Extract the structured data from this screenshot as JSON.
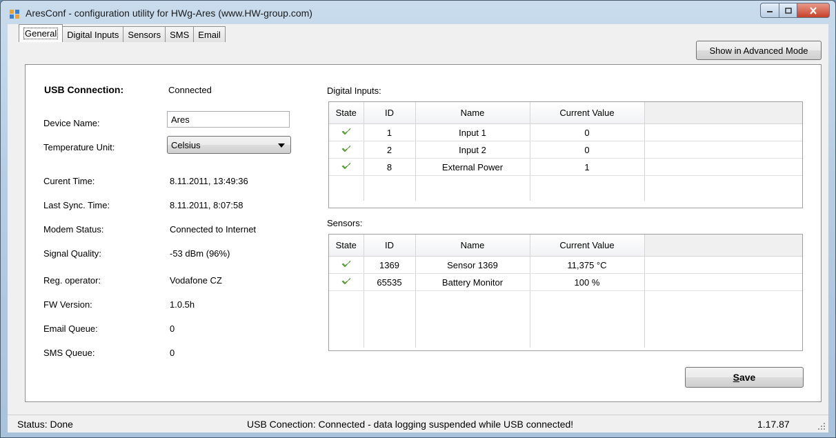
{
  "window": {
    "title": "AresConf - configuration utility for HWg-Ares (www.HW-group.com)"
  },
  "tabs": [
    "General",
    "Digital Inputs",
    "Sensors",
    "SMS",
    "Email"
  ],
  "toolbar": {
    "advanced_label": "Show in Advanced Mode"
  },
  "general": {
    "usb_label": "USB Connection:",
    "usb_value": "Connected",
    "device_name_label": "Device Name:",
    "device_name_value": "Ares",
    "temp_unit_label": "Temperature Unit:",
    "temp_unit_value": "Celsius",
    "info": [
      {
        "label": "Curent Time:",
        "value": "8.11.2011, 13:49:36"
      },
      {
        "label": "Last Sync. Time:",
        "value": "8.11.2011, 8:07:58"
      },
      {
        "label": "Modem Status:",
        "value": "Connected to Internet"
      },
      {
        "label": "Signal Quality:",
        "value": "-53 dBm (96%)"
      },
      {
        "label": "Reg. operator:",
        "value": "Vodafone CZ"
      },
      {
        "label": "FW Version:",
        "value": "1.0.5h"
      },
      {
        "label": "Email Queue:",
        "value": "0"
      },
      {
        "label": "SMS Queue:",
        "value": "0"
      }
    ]
  },
  "digital_inputs": {
    "title": "Digital Inputs:",
    "columns": [
      "State",
      "ID",
      "Name",
      "Current Value"
    ],
    "rows": [
      {
        "id": "1",
        "name": "Input 1",
        "value": "0"
      },
      {
        "id": "2",
        "name": "Input 2",
        "value": "0"
      },
      {
        "id": "8",
        "name": "External Power",
        "value": "1"
      }
    ]
  },
  "sensors": {
    "title": "Sensors:",
    "columns": [
      "State",
      "ID",
      "Name",
      "Current Value"
    ],
    "rows": [
      {
        "id": "1369",
        "name": "Sensor 1369",
        "value": "11,375 °C"
      },
      {
        "id": "65535",
        "name": "Battery Monitor",
        "value": "100 %"
      }
    ]
  },
  "actions": {
    "save_label": "Save"
  },
  "statusbar": {
    "status": "Status:  Done",
    "usb": "USB Conection:  Connected - data logging suspended while USB connected!",
    "version": "1.17.87"
  },
  "colors": {
    "check": "#5cb82e",
    "close_button": "#c5412a"
  }
}
